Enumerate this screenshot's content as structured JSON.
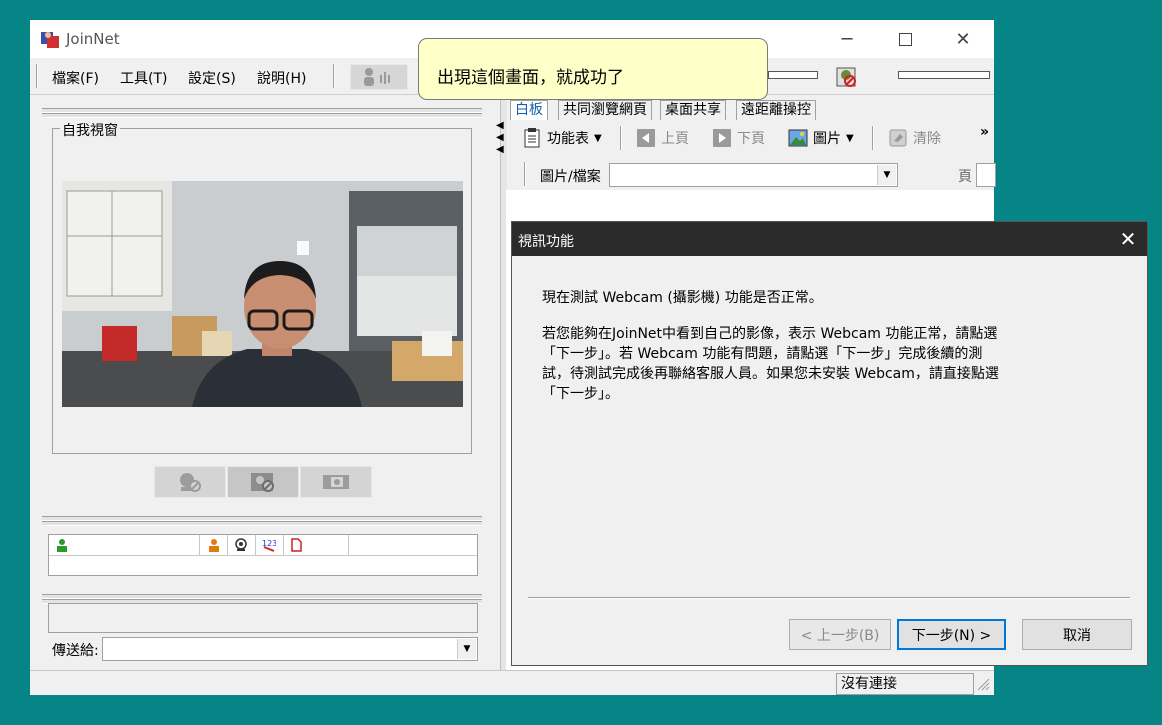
{
  "window": {
    "title": "JoinNet"
  },
  "menu": [
    "檔案(F)",
    "工具(T)",
    "設定(S)",
    "說明(H)"
  ],
  "callout": {
    "text": "出現這個畫面，就成功了"
  },
  "left": {
    "self_view_label": "自我視窗",
    "send_to_label": "傳送給:"
  },
  "tabs": [
    {
      "label": "白板",
      "active": true
    },
    {
      "label": "共同瀏覽網頁",
      "active": false
    },
    {
      "label": "桌面共享",
      "active": false
    },
    {
      "label": "遠距離操控",
      "active": false
    }
  ],
  "toolbar": {
    "function_table": "功能表",
    "prev_page": "上頁",
    "next_page": "下頁",
    "picture": "圖片",
    "clear": "清除",
    "more": "»"
  },
  "file_row": {
    "label": "圖片/檔案",
    "page_label": "頁"
  },
  "status": {
    "connection": "沒有連接"
  },
  "dialog": {
    "title": "視訊功能",
    "line1": "現在測試 Webcam (攝影機) 功能是否正常。",
    "para_lines": [
      "若您能夠在JoinNet中看到自己的影像，表示 Webcam 功能正常，請點選",
      "「下一步」。若 Webcam 功能有問題，請點選「下一步」完成後續的測",
      "試，待測試完成後再聯絡客服人員。如果您未安裝 Webcam，請直接點選",
      "「下一步」。"
    ],
    "back_button": "< 上一步(B)",
    "next_button": "下一步(N) >",
    "cancel_button": "取消"
  },
  "colors": {
    "desktop": "#058585",
    "callout_bg": "#ffffc8",
    "dialog_title_bg": "#2b2b2b",
    "active_tab_text": "#1560b0"
  },
  "icons": [
    "joinnet-app-icon",
    "minimize-icon",
    "maximize-icon",
    "close-icon",
    "microphone-icon",
    "speaker-icon",
    "user-icon",
    "webcam-icon",
    "phone-icon",
    "document-icon",
    "whiteboard-menu-icon",
    "prev-page-icon",
    "next-page-icon",
    "picture-icon",
    "clear-icon"
  ]
}
